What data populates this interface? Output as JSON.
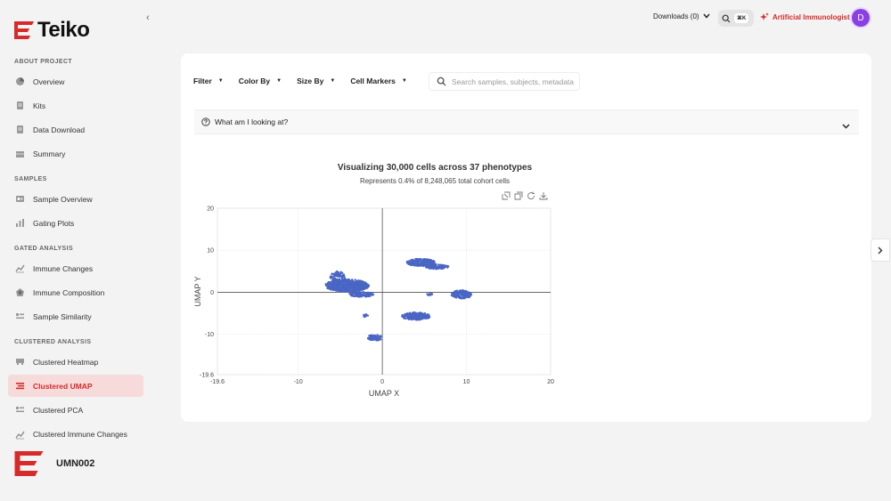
{
  "brand": {
    "name": "Teiko",
    "accent": "#d62b2b"
  },
  "sidebar": {
    "sections": [
      {
        "label": "ABOUT PROJECT",
        "items": [
          {
            "label": "Overview",
            "icon": "pie-icon"
          },
          {
            "label": "Kits",
            "icon": "document-icon"
          },
          {
            "label": "Data Download",
            "icon": "document-icon"
          },
          {
            "label": "Summary",
            "icon": "table-icon"
          }
        ]
      },
      {
        "label": "SAMPLES",
        "items": [
          {
            "label": "Sample Overview",
            "icon": "tube-icon"
          },
          {
            "label": "Gating Plots",
            "icon": "bar-chart-icon"
          }
        ]
      },
      {
        "label": "GATED ANALYSIS",
        "items": [
          {
            "label": "Immune Changes",
            "icon": "line-chart-icon"
          },
          {
            "label": "Immune Composition",
            "icon": "radar-icon"
          },
          {
            "label": "Sample Similarity",
            "icon": "list-icon"
          }
        ]
      },
      {
        "label": "CLUSTERED ANALYSIS",
        "items": [
          {
            "label": "Clustered Heatmap",
            "icon": "heatmap-icon"
          },
          {
            "label": "Clustered UMAP",
            "icon": "umap-icon",
            "active": true
          },
          {
            "label": "Clustered PCA",
            "icon": "list-icon"
          },
          {
            "label": "Clustered Immune Changes",
            "icon": "line-chart-icon"
          }
        ]
      }
    ],
    "org": "UMN002"
  },
  "topbar": {
    "downloads_label": "Downloads (0)",
    "shortcut": "⌘K",
    "ai_label": "Artificial Immunologist",
    "avatar_initial": "D"
  },
  "toolbar": {
    "filter": "Filter",
    "color_by": "Color By",
    "size_by": "Size By",
    "cell_markers": "Cell Markers",
    "search_placeholder": "Search samples, subjects, metadata"
  },
  "help": {
    "label": "What am I looking at?"
  },
  "chart_data": {
    "type": "scatter",
    "title": "Visualizing 30,000 cells across 37 phenotypes",
    "subtitle": "Represents 0.4% of 8,248,065 total cohort cells",
    "xlabel": "UMAP X",
    "ylabel": "UMAP Y",
    "xlim": [
      -19.6,
      20
    ],
    "ylim": [
      -19.6,
      20
    ],
    "xticks": [
      "-19.6",
      "-10",
      "0",
      "10",
      "20"
    ],
    "yticks": [
      "20",
      "10",
      "0",
      "-10",
      "-19.6"
    ],
    "grid": true,
    "point_color": "#4a66c4",
    "clusters": [
      {
        "x": -4.2,
        "y": 1.6,
        "rx": 2.6,
        "ry": 1.5,
        "n": 700
      },
      {
        "x": -5.3,
        "y": 3.6,
        "rx": 0.9,
        "ry": 1.4,
        "n": 120
      },
      {
        "x": -2.5,
        "y": -0.5,
        "rx": 1.5,
        "ry": 0.6,
        "n": 120
      },
      {
        "x": 4.6,
        "y": 7.1,
        "rx": 1.7,
        "ry": 0.9,
        "n": 260
      },
      {
        "x": 6.5,
        "y": 6.1,
        "rx": 1.4,
        "ry": 0.6,
        "n": 120
      },
      {
        "x": 4.0,
        "y": -5.7,
        "rx": 1.7,
        "ry": 0.9,
        "n": 280
      },
      {
        "x": 9.4,
        "y": -0.5,
        "rx": 1.2,
        "ry": 1.0,
        "n": 160
      },
      {
        "x": -0.9,
        "y": -10.8,
        "rx": 0.9,
        "ry": 0.7,
        "n": 90
      },
      {
        "x": 5.7,
        "y": -0.5,
        "rx": 0.4,
        "ry": 0.3,
        "n": 12
      },
      {
        "x": -2.0,
        "y": -5.6,
        "rx": 0.3,
        "ry": 0.4,
        "n": 10
      }
    ]
  }
}
